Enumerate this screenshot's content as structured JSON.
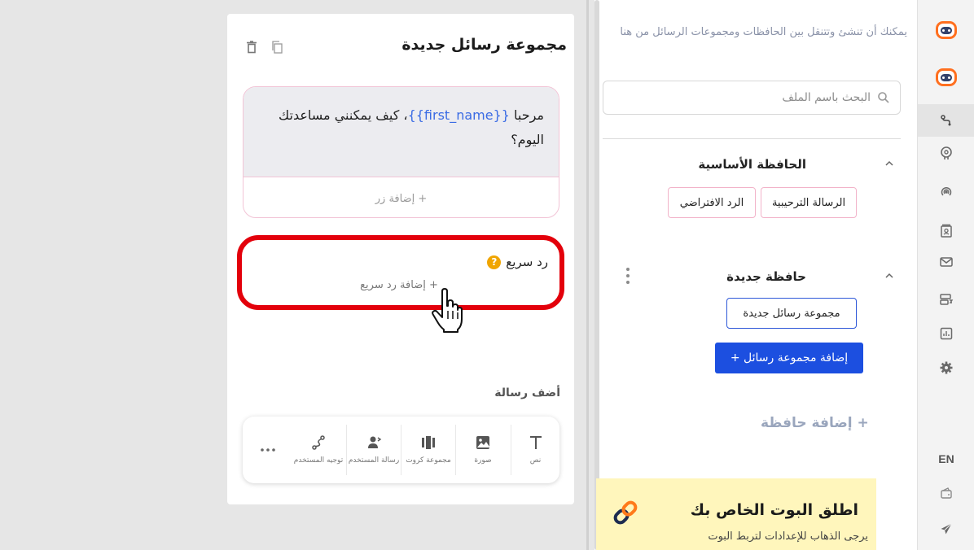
{
  "sidebar": {
    "items": [
      {
        "icon": "flow-icon",
        "active": true
      },
      {
        "icon": "brain-icon"
      },
      {
        "icon": "broadcast-icon"
      },
      {
        "icon": "contacts-icon"
      },
      {
        "icon": "mail-icon"
      },
      {
        "icon": "templates-icon"
      },
      {
        "icon": "analytics-icon"
      },
      {
        "icon": "gear-icon"
      }
    ],
    "lang": "EN",
    "accent": "#ff6f1f"
  },
  "folders": {
    "hint": "يمكنك أن تنشئ وتتنقل بين الحافظات ومجموعات الرسائل من هنا",
    "search_placeholder": "البحث باسم الملف",
    "main_folder": {
      "title": "الحافظة الأساسية",
      "chips": [
        "الرسالة الترحيبية",
        "الرد الافتراضي"
      ]
    },
    "new_folder": {
      "title": "حافظة جديدة",
      "chip": "مجموعة رسائل جديدة",
      "add_group": "إضافة مجموعة رسائل +"
    },
    "add_folder": "+ إضافة حافظة"
  },
  "promo": {
    "title": "اطلق البوت الخاص بك",
    "text": "يرجى الذهاب للإعدادات لتربط البوت"
  },
  "editor": {
    "title": "مجموعة رسائل جديدة",
    "message": {
      "prefix": "مرحبا ",
      "variable": "{{first_name}}",
      "suffix": "، كيف يمكنني مساعدتك اليوم؟",
      "add_button": "+ إضافة زر"
    },
    "quick_reply": {
      "label": "رد سريع",
      "add": "+ إضافة رد سريع"
    },
    "add_message_title": "أضف رسالة",
    "tools": [
      {
        "label": "نص",
        "icon": "text-icon"
      },
      {
        "label": "صورة",
        "icon": "image-icon"
      },
      {
        "label": "مجموعة كروت",
        "icon": "carousel-icon"
      },
      {
        "label": "رسالة المستخدم",
        "icon": "user-message-icon"
      },
      {
        "label": "توجيه المستخدم",
        "icon": "route-icon"
      }
    ],
    "more": "…",
    "highlight_color": "#e3000b"
  }
}
